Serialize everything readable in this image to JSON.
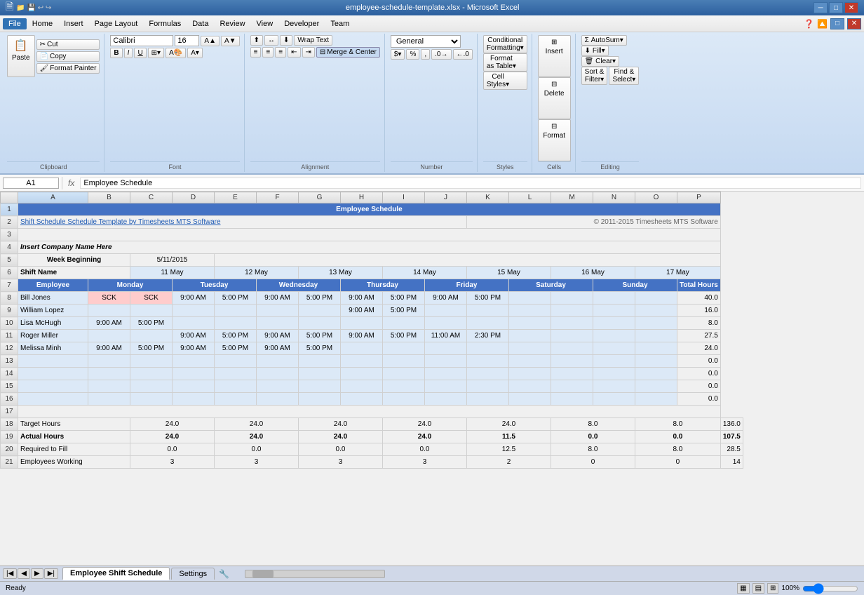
{
  "titleBar": {
    "title": "employee-schedule-template.xlsx - Microsoft Excel",
    "controls": [
      "─",
      "□",
      "✕"
    ]
  },
  "menuBar": {
    "items": [
      "File",
      "Home",
      "Insert",
      "Page Layout",
      "Formulas",
      "Data",
      "Review",
      "View",
      "Developer",
      "Team"
    ],
    "active": "Home"
  },
  "ribbon": {
    "groups": {
      "clipboard": {
        "label": "Clipboard",
        "paste": "Paste"
      },
      "font": {
        "label": "Font",
        "fontName": "Calibri",
        "fontSize": "16",
        "bold": "B",
        "italic": "I",
        "underline": "U"
      },
      "alignment": {
        "label": "Alignment",
        "wrapText": "Wrap Text",
        "mergeCenter": "Merge & Center"
      },
      "number": {
        "label": "Number",
        "format": "General"
      },
      "styles": {
        "label": "Styles",
        "conditional": "Conditional Formatting",
        "formatTable": "Format as Table",
        "cellStyles": "Cell Styles"
      },
      "cells": {
        "label": "Cells",
        "insert": "Insert",
        "delete": "Delete",
        "format": "Format"
      },
      "editing": {
        "label": "Editing",
        "autoSum": "AutoSum",
        "fill": "Fill",
        "clear": "Clear",
        "sortFilter": "Sort & Filter",
        "findSelect": "Find & Select"
      }
    }
  },
  "formulaBar": {
    "nameBox": "A1",
    "formula": "Employee Schedule"
  },
  "columns": [
    "A",
    "B",
    "C",
    "D",
    "E",
    "F",
    "G",
    "H",
    "I",
    "J",
    "K",
    "L",
    "M",
    "N",
    "O",
    "P"
  ],
  "rows": {
    "1": {
      "A": "Employee Schedule",
      "merged": true
    },
    "2": {
      "A": "Shift Schedule Schedule Template by Timesheets MTS Software",
      "P": "© 2011-2015 Timesheets MTS Software"
    },
    "3": {},
    "4": {
      "A": "Insert Company Name Here"
    },
    "5": {
      "label_col": "Week Beginning",
      "B": "5/11/2015"
    },
    "6": {
      "A": "Shift Name",
      "C": "11 May",
      "E": "12 May",
      "G": "13 May",
      "I": "14 May",
      "K": "15 May",
      "M": "16 May",
      "O": "17 May"
    },
    "7": {
      "A": "Employee",
      "B": "Monday",
      "D": "Tuesday",
      "F": "Wednesday",
      "H": "Thursday",
      "J": "Friday",
      "L": "Saturday",
      "N": "Sunday",
      "P": "Total Hours"
    },
    "8": {
      "A": "Bill Jones",
      "B": "SCK",
      "C": "SCK",
      "D": "9:00 AM",
      "E": "5:00 PM",
      "F": "9:00 AM",
      "G": "5:00 PM",
      "H": "9:00 AM",
      "I": "5:00 PM",
      "J": "9:00 AM",
      "K": "5:00 PM",
      "P": "40.0"
    },
    "9": {
      "A": "William Lopez",
      "H": "9:00 AM",
      "I": "5:00 PM",
      "P": "16.0"
    },
    "10": {
      "A": "Lisa McHugh",
      "B": "9:00 AM",
      "C": "5:00 PM",
      "P": "8.0"
    },
    "11": {
      "A": "Roger Miller",
      "D": "9:00 AM",
      "E": "5:00 PM",
      "F": "9:00 AM",
      "G": "5:00 PM",
      "H": "9:00 AM",
      "I": "5:00 PM",
      "J": "11:00 AM",
      "K": "2:30 PM",
      "P": "27.5"
    },
    "12": {
      "A": "Melissa Minh",
      "B": "9:00 AM",
      "C": "5:00 PM",
      "D": "9:00 AM",
      "E": "5:00 PM",
      "F": "9:00 AM",
      "G": "5:00 PM",
      "P": "24.0"
    },
    "13": {
      "P": "0.0"
    },
    "14": {
      "P": "0.0"
    },
    "15": {
      "P": "0.0"
    },
    "16": {
      "P": "0.0"
    },
    "17": {},
    "18": {
      "A": "Target Hours",
      "C": "24.0",
      "E": "24.0",
      "G": "24.0",
      "I": "24.0",
      "K": "24.0",
      "M": "8.0",
      "O": "8.0",
      "P": "136.0"
    },
    "19": {
      "A": "Actual Hours",
      "C": "24.0",
      "E": "24.0",
      "G": "24.0",
      "I": "24.0",
      "K": "11.5",
      "M": "0.0",
      "O": "0.0",
      "P": "107.5"
    },
    "20": {
      "A": "Required to Fill",
      "C": "0.0",
      "E": "0.0",
      "G": "0.0",
      "I": "0.0",
      "K": "12.5",
      "M": "8.0",
      "O": "8.0",
      "P": "28.5"
    },
    "21": {
      "A": "Employees Working",
      "C": "3",
      "E": "3",
      "G": "3",
      "I": "3",
      "K": "2",
      "M": "0",
      "O": "0",
      "P": "14"
    }
  },
  "sheetTabs": {
    "active": "Employee Shift Schedule",
    "tabs": [
      "Employee Shift Schedule",
      "Settings"
    ]
  },
  "statusBar": {
    "status": "Ready",
    "zoom": "100%"
  }
}
